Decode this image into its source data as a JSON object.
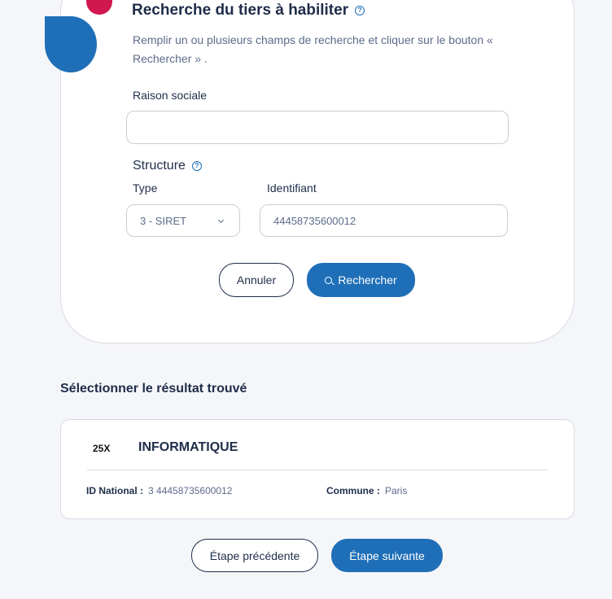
{
  "search": {
    "title": "Recherche du tiers à habiliter",
    "help_glyph": "?",
    "instructions": "Remplir un ou plusieurs champs de recherche et cliquer sur le bouton « Rechercher » .",
    "raison_sociale_label": "Raison sociale",
    "raison_sociale_value": "",
    "structure_label": "Structure",
    "type_label": "Type",
    "type_value": "3 - SIRET",
    "identifiant_label": "Identifiant",
    "identifiant_value": "44458735600012",
    "cancel_label": "Annuler",
    "search_label": "Rechercher"
  },
  "results": {
    "heading": "Sélectionner le résultat trouvé",
    "item": {
      "code": "25X",
      "name": "INFORMATIQUE",
      "id_label": "ID National :",
      "id_value": "3 44458735600012",
      "commune_label": "Commune :",
      "commune_value": "Paris"
    }
  },
  "footer": {
    "prev_label": "Étape précédente",
    "next_label": "Étape suivante"
  },
  "colors": {
    "primary": "#1f6fb8",
    "accent": "#d1174f",
    "text": "#1f2d4a",
    "muted": "#5d6b8a"
  }
}
